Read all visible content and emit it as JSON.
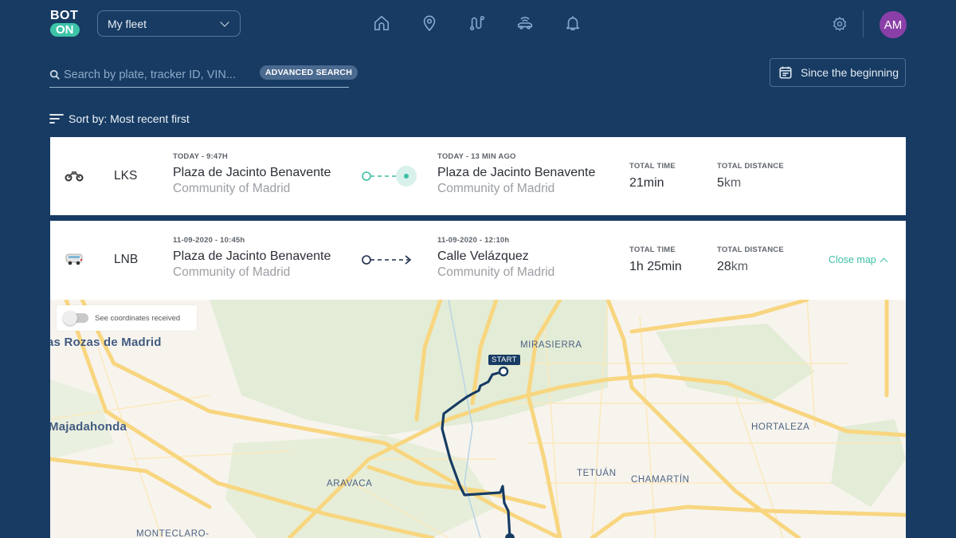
{
  "app": {
    "logo_top": "BOT",
    "logo_bottom": "ON",
    "fleet_selector": {
      "value": "My fleet"
    },
    "nav": [
      {
        "icon": "home-icon",
        "label": "Home"
      },
      {
        "icon": "location-pin-icon",
        "label": "Locations"
      },
      {
        "icon": "route-icon",
        "label": "Trips"
      },
      {
        "icon": "connected-car-icon",
        "label": "Vehicles"
      },
      {
        "icon": "bell-icon",
        "label": "Notifications"
      }
    ],
    "settings_icon": "gear-icon",
    "user_initials": "AM",
    "avatar_color": "#8a3fa8"
  },
  "search": {
    "placeholder": "Search by plate, tracker ID, VIN...",
    "value": "",
    "advanced_label": "ADVANCED SEARCH"
  },
  "date_filter": {
    "label": "Since the beginning"
  },
  "sort": {
    "label": "Sort by: Most recent first"
  },
  "trips": [
    {
      "vehicle_type": "motorcycle",
      "plate": "LKS",
      "from": {
        "time": "TODAY - 9:47H",
        "place": "Plaza de Jacinto Benavente",
        "region": "Community of Madrid"
      },
      "to": {
        "time": "TODAY - 13 MIN AGO",
        "place": "Plaza de Jacinto Benavente",
        "region": "Community of Madrid"
      },
      "status": "in-progress",
      "total_time_label": "TOTAL TIME",
      "total_time": "21min",
      "total_distance_label": "TOTAL DISTANCE",
      "total_distance_value": "5",
      "total_distance_unit": "km"
    },
    {
      "vehicle_type": "van",
      "plate": "LNB",
      "from": {
        "time": "11-09-2020 - 10:45h",
        "place": "Plaza de Jacinto Benavente",
        "region": "Community of Madrid"
      },
      "to": {
        "time": "11-09-2020 - 12:10h",
        "place": "Calle Velázquez",
        "region": "Community of Madrid"
      },
      "status": "completed",
      "total_time_label": "TOTAL TIME",
      "total_time": "1h 25min",
      "total_distance_label": "TOTAL DISTANCE",
      "total_distance_value": "28",
      "total_distance_unit": "km",
      "close_map_label": "Close map"
    }
  ],
  "map": {
    "toggle_label": "See coordinates received",
    "toggle_on": false,
    "start_label": "START",
    "labels": {
      "las_rozas": "as Rozas de Madrid",
      "majadahonda": "Majadahonda",
      "mirasierra": "MIRASIERRA",
      "hortaleza": "HORTALEZA",
      "tetuan": "TETUÁN",
      "chamartin": "CHAMARTÍN",
      "aravaca": "ARAVACA",
      "monteclaro": "MONTECLARO-"
    }
  },
  "colors": {
    "background": "#173b63",
    "accent": "#3cc3a8",
    "route": "#173b63"
  }
}
